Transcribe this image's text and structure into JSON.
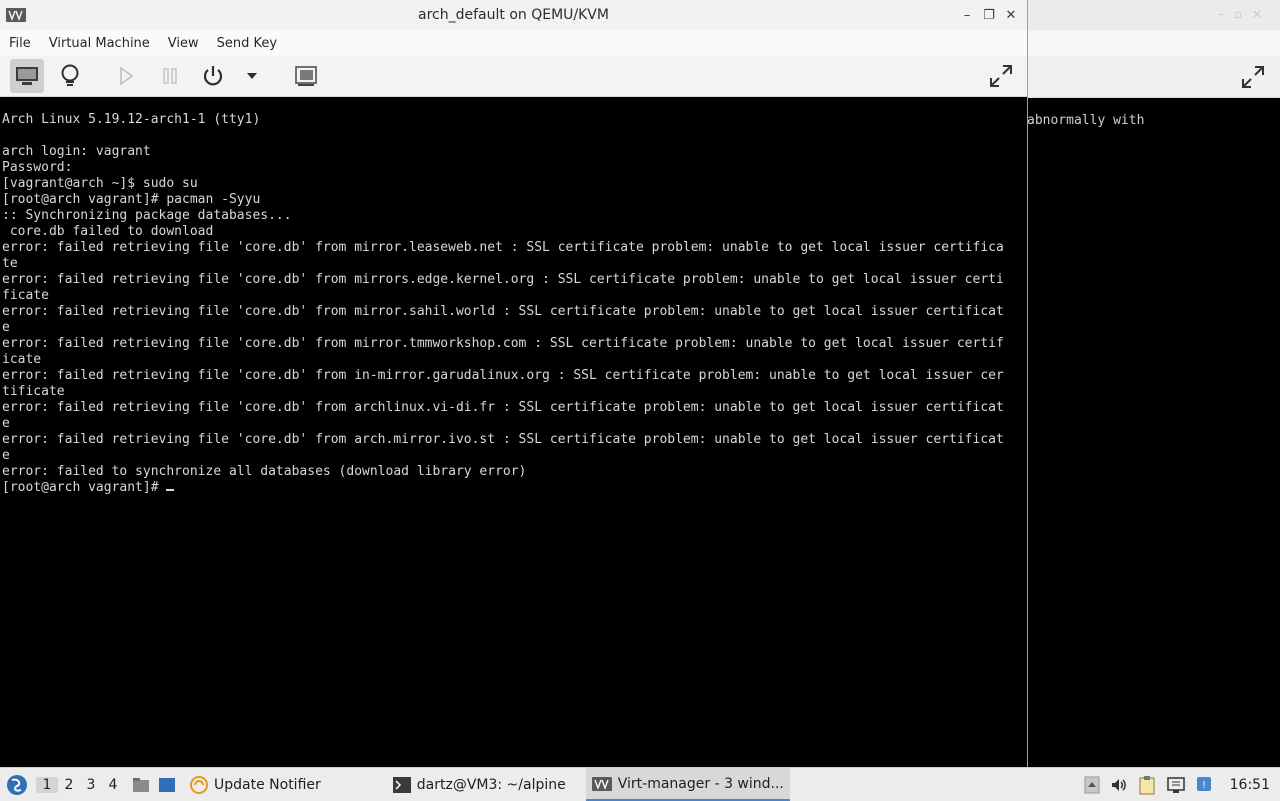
{
  "window": {
    "title": "arch_default on QEMU/KVM",
    "min_glyph": "–",
    "max_glyph": "❐",
    "close_glyph": "✕"
  },
  "menubar": {
    "items": [
      "File",
      "Virtual Machine",
      "View",
      "Send Key"
    ]
  },
  "toolbar": {
    "icons": [
      "monitor-icon",
      "lightbulb-icon",
      "play-icon",
      "pause-icon",
      "power-icon",
      "dropdown-arrow-icon",
      "snapshots-icon",
      "fullscreen-icon"
    ]
  },
  "background_window": {
    "console_text": "abnormally with"
  },
  "console": {
    "lines": [
      "Arch Linux 5.19.12-arch1-1 (tty1)",
      "",
      "arch login: vagrant",
      "Password:",
      "[vagrant@arch ~]$ sudo su",
      "[root@arch vagrant]# pacman -Syyu",
      ":: Synchronizing package databases...",
      " core.db failed to download",
      "error: failed retrieving file 'core.db' from mirror.leaseweb.net : SSL certificate problem: unable to get local issuer certifica",
      "te",
      "error: failed retrieving file 'core.db' from mirrors.edge.kernel.org : SSL certificate problem: unable to get local issuer certi",
      "ficate",
      "error: failed retrieving file 'core.db' from mirror.sahil.world : SSL certificate problem: unable to get local issuer certificat",
      "e",
      "error: failed retrieving file 'core.db' from mirror.tmmworkshop.com : SSL certificate problem: unable to get local issuer certif",
      "icate",
      "error: failed retrieving file 'core.db' from in-mirror.garudalinux.org : SSL certificate problem: unable to get local issuer cer",
      "tificate",
      "error: failed retrieving file 'core.db' from archlinux.vi-di.fr : SSL certificate problem: unable to get local issuer certificat",
      "e",
      "error: failed retrieving file 'core.db' from arch.mirror.ivo.st : SSL certificate problem: unable to get local issuer certificat",
      "e",
      "error: failed to synchronize all databases (download library error)"
    ],
    "prompt": "[root@arch vagrant]# "
  },
  "taskbar": {
    "desktops": [
      "1",
      "2",
      "3",
      "4"
    ],
    "active_desktop": "1",
    "tasks": [
      {
        "label": "Update Notifier",
        "icon": "update-notifier-icon"
      },
      {
        "label": "dartz@VM3: ~/alpine",
        "icon": "terminal-icon"
      },
      {
        "label": "Virt-manager - 3 wind...",
        "icon": "virt-manager-icon"
      }
    ],
    "clock": "16:51"
  },
  "colors": {
    "accent": "#4a86c9",
    "console_bg": "#000000",
    "console_fg": "#d8d8d8"
  }
}
